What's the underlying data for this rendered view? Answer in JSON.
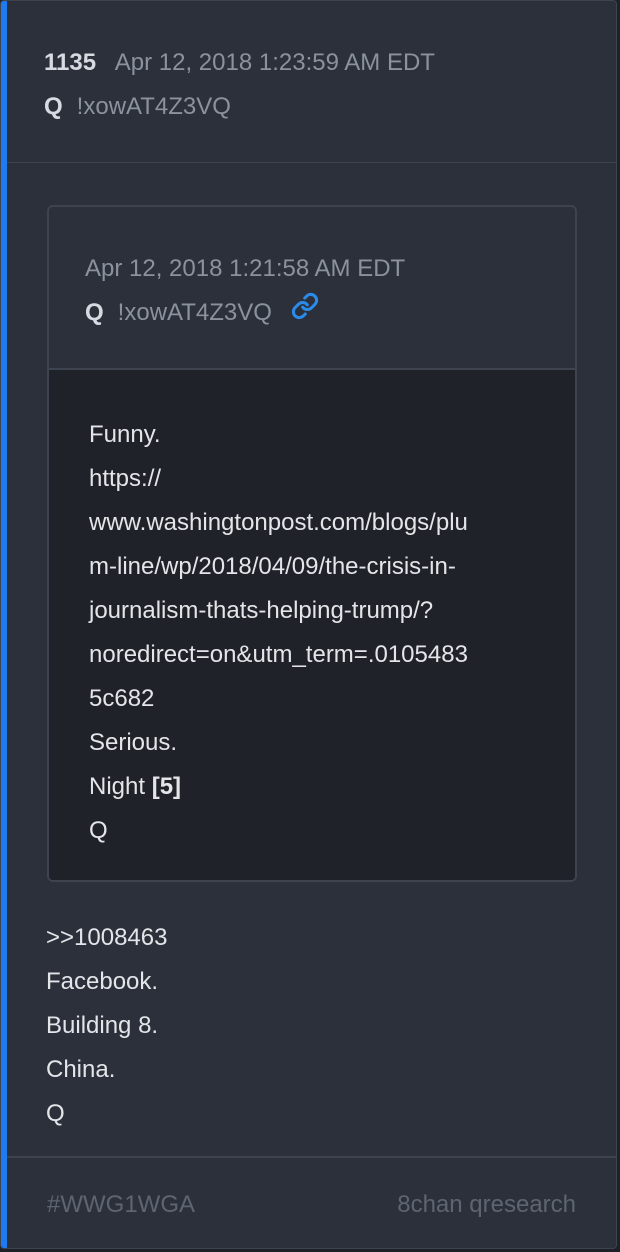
{
  "post": {
    "number": "1135",
    "timestamp": "Apr 12, 2018 1:23:59 AM EDT",
    "author": "Q",
    "tripcode": "!xowAT4Z3VQ"
  },
  "quoted_post": {
    "timestamp": "Apr 12, 2018 1:21:58 AM EDT",
    "author": "Q",
    "tripcode": "!xowAT4Z3VQ",
    "link_icon": "link-icon",
    "lines": [
      "Funny.",
      "https://",
      "www.washingtonpost.com/blogs/plu",
      "m-line/wp/2018/04/09/the-crisis-in-",
      "journalism-thats-helping-trump/?",
      "noredirect=on&utm_term=.0105483",
      "5c682",
      "Serious."
    ],
    "night_text": "Night",
    "night_ref": "[5]",
    "signature": "Q"
  },
  "body": {
    "lines": [
      ">>1008463",
      "Facebook.",
      "Building 8.",
      "China.",
      "Q"
    ]
  },
  "footer": {
    "hashtag": "#WWG1WGA",
    "source": "8chan qresearch"
  },
  "colors": {
    "accent": "#1d7cf2",
    "link": "#2a8be8",
    "card_bg": "#2b303b",
    "quote_body_bg": "#1f2229"
  }
}
